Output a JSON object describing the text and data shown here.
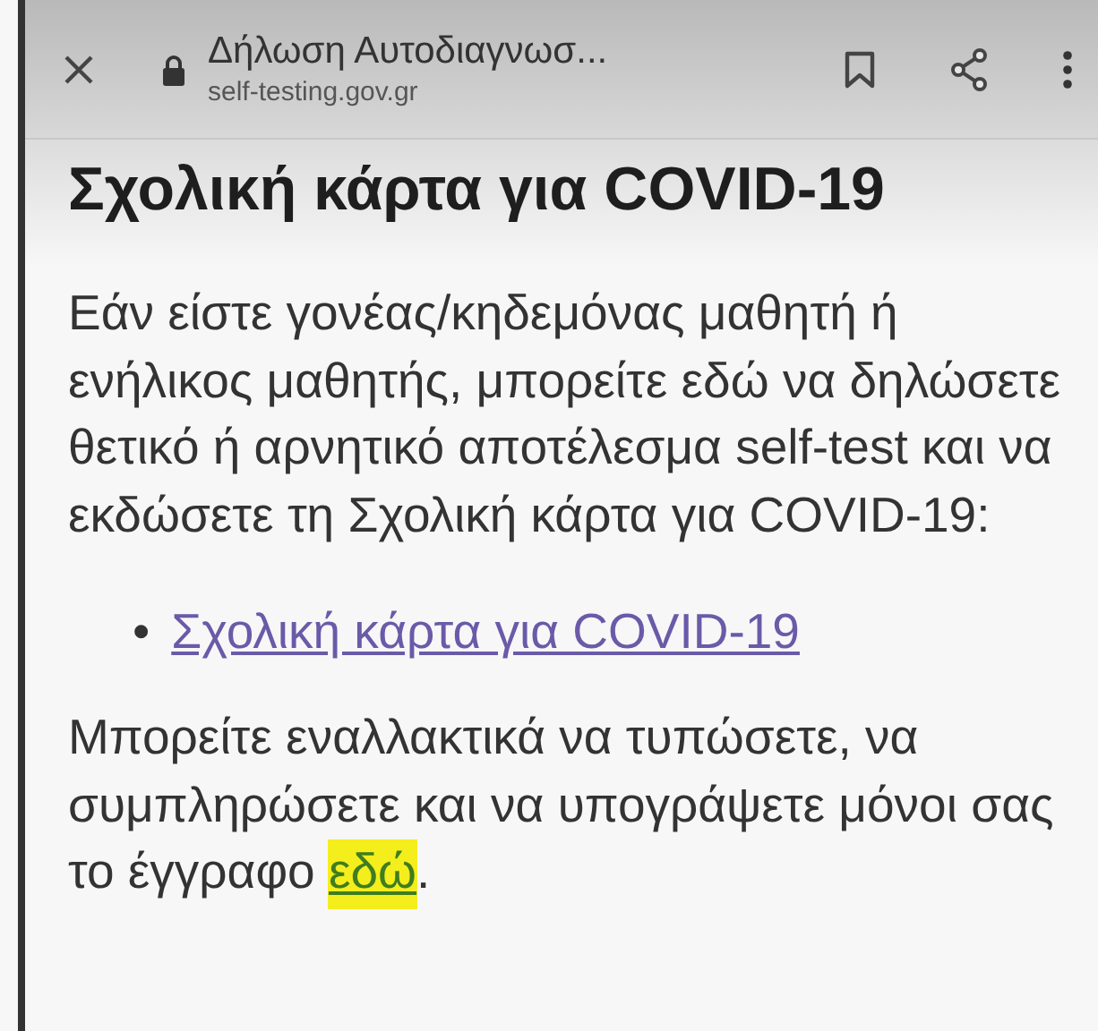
{
  "browser_bar": {
    "page_title": "Δήλωση Αυτοδιαγνωσ...",
    "url": "self-testing.gov.gr"
  },
  "heading": "Σχολική κάρτα για COVID-19",
  "intro": "Εάν είστε γονέας/κηδεμόνας μαθητή ή ενήλικος μαθητής, μπορείτε εδώ να δηλώσετε θετικό ή αρνητικό αποτέλεσμα self-test και να εκδώσετε τη Σχολική κάρτα για COVID-19:",
  "links": [
    {
      "marker": "•",
      "text": "Σχολική κάρτα για COVID-19"
    }
  ],
  "note": {
    "before": "Μπορείτε εναλλακτικά να τυπώσετε, να συμπληρώσετε και να υπογράψετε μόνοι σας το έγγραφο ",
    "link": "εδώ",
    "after": ".",
    "highlighted": true
  }
}
